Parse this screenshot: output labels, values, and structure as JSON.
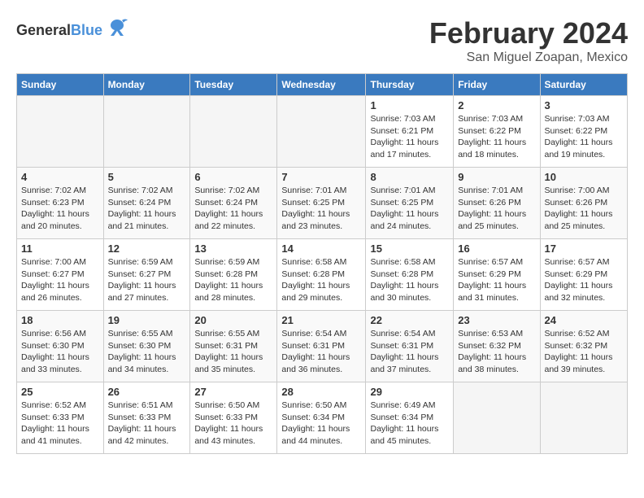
{
  "logo": {
    "general": "General",
    "blue": "Blue"
  },
  "title": "February 2024",
  "location": "San Miguel Zoapan, Mexico",
  "days_header": [
    "Sunday",
    "Monday",
    "Tuesday",
    "Wednesday",
    "Thursday",
    "Friday",
    "Saturday"
  ],
  "weeks": [
    [
      {
        "day": "",
        "info": ""
      },
      {
        "day": "",
        "info": ""
      },
      {
        "day": "",
        "info": ""
      },
      {
        "day": "",
        "info": ""
      },
      {
        "day": "1",
        "info": "Sunrise: 7:03 AM\nSunset: 6:21 PM\nDaylight: 11 hours\nand 17 minutes."
      },
      {
        "day": "2",
        "info": "Sunrise: 7:03 AM\nSunset: 6:22 PM\nDaylight: 11 hours\nand 18 minutes."
      },
      {
        "day": "3",
        "info": "Sunrise: 7:03 AM\nSunset: 6:22 PM\nDaylight: 11 hours\nand 19 minutes."
      }
    ],
    [
      {
        "day": "4",
        "info": "Sunrise: 7:02 AM\nSunset: 6:23 PM\nDaylight: 11 hours\nand 20 minutes."
      },
      {
        "day": "5",
        "info": "Sunrise: 7:02 AM\nSunset: 6:24 PM\nDaylight: 11 hours\nand 21 minutes."
      },
      {
        "day": "6",
        "info": "Sunrise: 7:02 AM\nSunset: 6:24 PM\nDaylight: 11 hours\nand 22 minutes."
      },
      {
        "day": "7",
        "info": "Sunrise: 7:01 AM\nSunset: 6:25 PM\nDaylight: 11 hours\nand 23 minutes."
      },
      {
        "day": "8",
        "info": "Sunrise: 7:01 AM\nSunset: 6:25 PM\nDaylight: 11 hours\nand 24 minutes."
      },
      {
        "day": "9",
        "info": "Sunrise: 7:01 AM\nSunset: 6:26 PM\nDaylight: 11 hours\nand 25 minutes."
      },
      {
        "day": "10",
        "info": "Sunrise: 7:00 AM\nSunset: 6:26 PM\nDaylight: 11 hours\nand 25 minutes."
      }
    ],
    [
      {
        "day": "11",
        "info": "Sunrise: 7:00 AM\nSunset: 6:27 PM\nDaylight: 11 hours\nand 26 minutes."
      },
      {
        "day": "12",
        "info": "Sunrise: 6:59 AM\nSunset: 6:27 PM\nDaylight: 11 hours\nand 27 minutes."
      },
      {
        "day": "13",
        "info": "Sunrise: 6:59 AM\nSunset: 6:28 PM\nDaylight: 11 hours\nand 28 minutes."
      },
      {
        "day": "14",
        "info": "Sunrise: 6:58 AM\nSunset: 6:28 PM\nDaylight: 11 hours\nand 29 minutes."
      },
      {
        "day": "15",
        "info": "Sunrise: 6:58 AM\nSunset: 6:28 PM\nDaylight: 11 hours\nand 30 minutes."
      },
      {
        "day": "16",
        "info": "Sunrise: 6:57 AM\nSunset: 6:29 PM\nDaylight: 11 hours\nand 31 minutes."
      },
      {
        "day": "17",
        "info": "Sunrise: 6:57 AM\nSunset: 6:29 PM\nDaylight: 11 hours\nand 32 minutes."
      }
    ],
    [
      {
        "day": "18",
        "info": "Sunrise: 6:56 AM\nSunset: 6:30 PM\nDaylight: 11 hours\nand 33 minutes."
      },
      {
        "day": "19",
        "info": "Sunrise: 6:55 AM\nSunset: 6:30 PM\nDaylight: 11 hours\nand 34 minutes."
      },
      {
        "day": "20",
        "info": "Sunrise: 6:55 AM\nSunset: 6:31 PM\nDaylight: 11 hours\nand 35 minutes."
      },
      {
        "day": "21",
        "info": "Sunrise: 6:54 AM\nSunset: 6:31 PM\nDaylight: 11 hours\nand 36 minutes."
      },
      {
        "day": "22",
        "info": "Sunrise: 6:54 AM\nSunset: 6:31 PM\nDaylight: 11 hours\nand 37 minutes."
      },
      {
        "day": "23",
        "info": "Sunrise: 6:53 AM\nSunset: 6:32 PM\nDaylight: 11 hours\nand 38 minutes."
      },
      {
        "day": "24",
        "info": "Sunrise: 6:52 AM\nSunset: 6:32 PM\nDaylight: 11 hours\nand 39 minutes."
      }
    ],
    [
      {
        "day": "25",
        "info": "Sunrise: 6:52 AM\nSunset: 6:33 PM\nDaylight: 11 hours\nand 41 minutes."
      },
      {
        "day": "26",
        "info": "Sunrise: 6:51 AM\nSunset: 6:33 PM\nDaylight: 11 hours\nand 42 minutes."
      },
      {
        "day": "27",
        "info": "Sunrise: 6:50 AM\nSunset: 6:33 PM\nDaylight: 11 hours\nand 43 minutes."
      },
      {
        "day": "28",
        "info": "Sunrise: 6:50 AM\nSunset: 6:34 PM\nDaylight: 11 hours\nand 44 minutes."
      },
      {
        "day": "29",
        "info": "Sunrise: 6:49 AM\nSunset: 6:34 PM\nDaylight: 11 hours\nand 45 minutes."
      },
      {
        "day": "",
        "info": ""
      },
      {
        "day": "",
        "info": ""
      }
    ]
  ]
}
